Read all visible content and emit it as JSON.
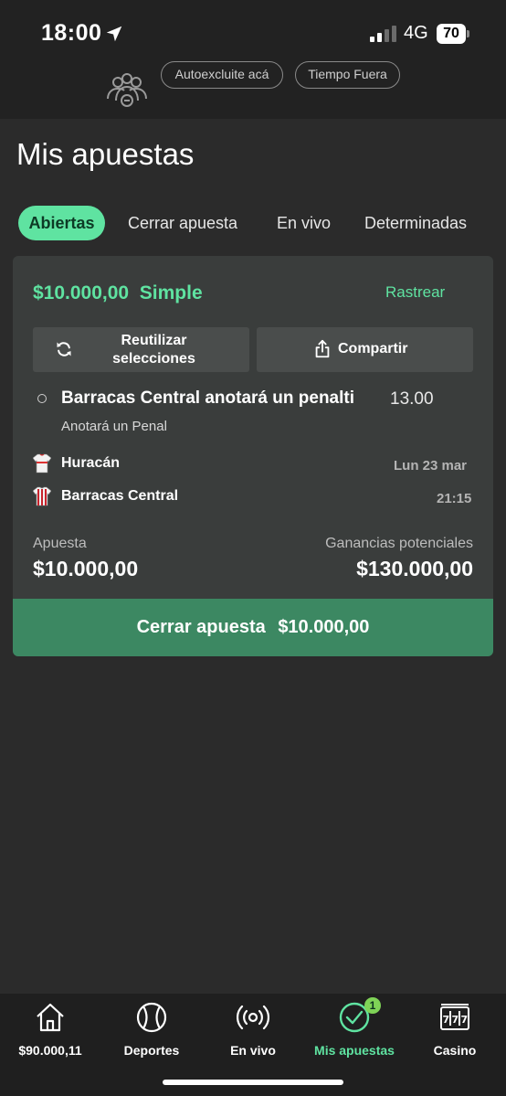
{
  "status_bar": {
    "time": "18:00",
    "network": "4G",
    "battery": "70"
  },
  "header_links": {
    "autoexclusion": "Autoexcluite acá",
    "time_out": "Tiempo Fuera"
  },
  "page": {
    "title": "Mis apuestas"
  },
  "tabs": [
    {
      "label": "Abiertas",
      "active": true
    },
    {
      "label": "Cerrar apuesta",
      "active": false
    },
    {
      "label": "En vivo",
      "active": false
    },
    {
      "label": "Determinadas",
      "active": false
    }
  ],
  "bet": {
    "stake_and_type": "$10.000,00  Simple",
    "track_label": "Rastrear",
    "reuse_label": "Reutilizar selecciones",
    "share_label": "Compartir",
    "selection": "Barracas Central anotará un penalti",
    "odds": "13.00",
    "market": "Anotará un Penal",
    "home_team": "Huracán",
    "away_team": "Barracas Central",
    "date": "Lun 23 mar",
    "time": "21:15",
    "stake_label": "Apuesta",
    "stake_value": "$10.000,00",
    "winnings_label": "Ganancias potenciales",
    "winnings_value": "$130.000,00",
    "cashout_label": "Cerrar apuesta",
    "cashout_value": "$10.000,00"
  },
  "bottom_nav": [
    {
      "label": "$90.000,11",
      "icon": "home-icon"
    },
    {
      "label": "Deportes",
      "icon": "ball-icon"
    },
    {
      "label": "En vivo",
      "icon": "live-icon"
    },
    {
      "label": "Mis apuestas",
      "icon": "check-circle-icon",
      "badge": "1",
      "active": true
    },
    {
      "label": "Casino",
      "icon": "slot-machine-icon"
    }
  ],
  "colors": {
    "accent": "#5fe3a1",
    "cashout": "#3c8862",
    "background": "#2b2b2b",
    "card": "#3a3d3c"
  }
}
